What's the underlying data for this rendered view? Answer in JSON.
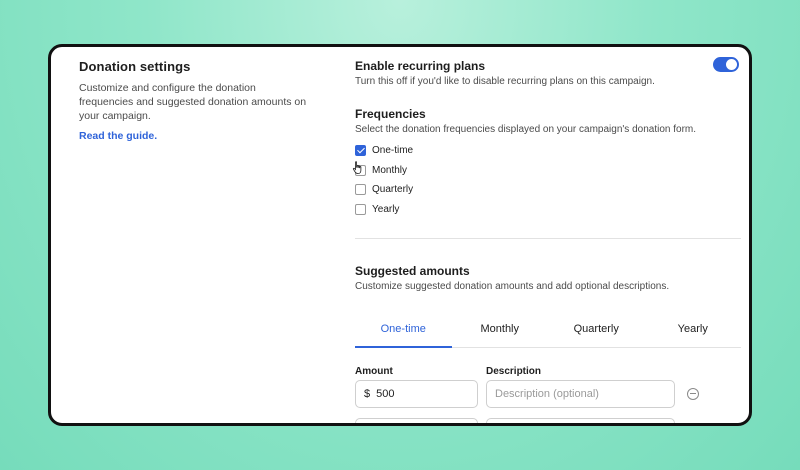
{
  "donation_settings": {
    "title": "Donation settings",
    "description": "Customize and configure the donation frequencies and suggested donation amounts on your campaign.",
    "guide_link": "Read the guide."
  },
  "recurring": {
    "title": "Enable recurring plans",
    "description": "Turn this off if you'd like to disable recurring plans on this campaign.",
    "enabled": true
  },
  "frequencies": {
    "title": "Frequencies",
    "description": "Select the donation frequencies displayed on your campaign's donation form.",
    "options": [
      {
        "label": "One-time",
        "checked": true
      },
      {
        "label": "Monthly",
        "checked": false
      },
      {
        "label": "Quarterly",
        "checked": false
      },
      {
        "label": "Yearly",
        "checked": false
      }
    ]
  },
  "suggested_amounts": {
    "title": "Suggested amounts",
    "description": "Customize suggested donation amounts and add optional descriptions.",
    "tabs": [
      {
        "label": "One-time",
        "active": true
      },
      {
        "label": "Monthly",
        "active": false
      },
      {
        "label": "Quarterly",
        "active": false
      },
      {
        "label": "Yearly",
        "active": false
      }
    ],
    "amount_label": "Amount",
    "description_label": "Description",
    "rows": [
      {
        "currency": "$",
        "amount": "500",
        "description_placeholder": "Description (optional)"
      }
    ]
  },
  "colors": {
    "accent": "#2f63d9",
    "background": "#8fe6c9"
  }
}
